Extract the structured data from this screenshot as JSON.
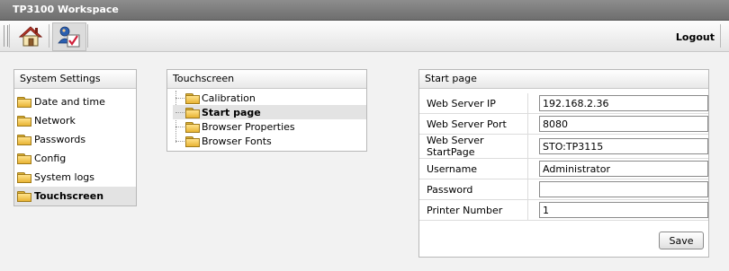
{
  "app": {
    "title": "TP3100 Workspace"
  },
  "toolbar": {
    "home_icon": "home-icon",
    "users_icon": "user-settings-icon",
    "logout_label": "Logout"
  },
  "system_settings": {
    "title": "System Settings",
    "items": [
      {
        "label": "Date and time",
        "active": false
      },
      {
        "label": "Network",
        "active": false
      },
      {
        "label": "Passwords",
        "active": false
      },
      {
        "label": "Config",
        "active": false
      },
      {
        "label": "System logs",
        "active": false
      },
      {
        "label": "Touchscreen",
        "active": true
      }
    ]
  },
  "touchscreen": {
    "title": "Touchscreen",
    "items": [
      {
        "label": "Calibration",
        "active": false
      },
      {
        "label": "Start page",
        "active": true
      },
      {
        "label": "Browser Properties",
        "active": false
      },
      {
        "label": "Browser Fonts",
        "active": false
      }
    ]
  },
  "start_page": {
    "title": "Start page",
    "fields": [
      {
        "label": "Web Server IP",
        "value": "192.168.2.36"
      },
      {
        "label": "Web Server Port",
        "value": "8080"
      },
      {
        "label": "Web Server StartPage",
        "value": "STO:TP3115"
      },
      {
        "label": "Username",
        "value": "Administrator"
      },
      {
        "label": "Password",
        "value": ""
      },
      {
        "label": "Printer Number",
        "value": "1"
      }
    ],
    "save_label": "Save"
  }
}
